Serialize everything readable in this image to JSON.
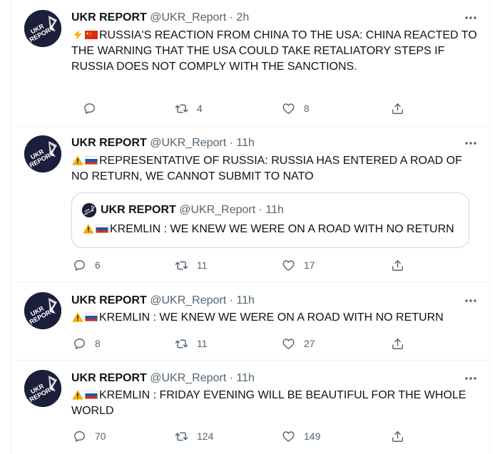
{
  "tweets": [
    {
      "name": "UKR REPORT",
      "handle": "@UKR_Report",
      "dot": "·",
      "time": "2h",
      "text": "RUSSIA'S REACTION FROM CHINA TO THE USA: CHINA REACTED TO THE WARNING THAT THE USA COULD TAKE RETALIATORY STEPS IF RUSSIA DOES NOT COMPLY WITH THE SANCTIONS.",
      "lead_icons": [
        "lightning-icon",
        "china-flag-icon"
      ],
      "replies": "",
      "retweets": "4",
      "likes": "8"
    },
    {
      "name": "UKR REPORT",
      "handle": "@UKR_Report",
      "dot": "·",
      "time": "11h",
      "text": "REPRESENTATIVE OF RUSSIA: RUSSIA HAS ENTERED A ROAD OF NO RETURN, WE CANNOT SUBMIT TO NATO",
      "lead_icons": [
        "warning-icon",
        "russia-flag-icon"
      ],
      "quote": {
        "name": "UKR REPORT",
        "handle": "@UKR_Report",
        "dot": "·",
        "time": "11h",
        "text": "KREMLIN : WE KNEW WE WERE ON A ROAD WITH NO RETURN"
      },
      "replies": "6",
      "retweets": "11",
      "likes": "17"
    },
    {
      "name": "UKR REPORT",
      "handle": "@UKR_Report",
      "dot": "·",
      "time": "11h",
      "text": "KREMLIN : WE KNEW WE WERE ON A ROAD WITH NO RETURN",
      "lead_icons": [
        "warning-icon",
        "russia-flag-icon"
      ],
      "replies": "8",
      "retweets": "11",
      "likes": "27"
    },
    {
      "name": "UKR REPORT",
      "handle": "@UKR_Report",
      "dot": "·",
      "time": "11h",
      "text": "KREMLIN : FRIDAY EVENING WILL BE BEAUTIFUL FOR THE WHOLE WORLD",
      "lead_icons": [
        "warning-icon",
        "russia-flag-icon"
      ],
      "replies": "70",
      "retweets": "124",
      "likes": "149"
    }
  ],
  "colors": {
    "text": "#0f1419",
    "muted": "#536471",
    "border": "#eff3f4",
    "avatar_bg": "#1b1f3b",
    "avatar_fg": "#ffffff"
  },
  "icons": {
    "reply": "reply-icon",
    "retweet": "retweet-icon",
    "like": "heart-icon",
    "share": "share-icon",
    "more": "more-icon",
    "avatar": "ukr-report-logo"
  }
}
